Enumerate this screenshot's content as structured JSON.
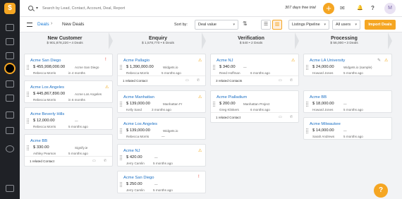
{
  "topbar": {
    "search_placeholder": "Search by Lead, Contact, Account, Deal, Report",
    "trial_text": "307 days free trial",
    "plus": "+",
    "mail_icon": "✉",
    "bell_icon": "🔔",
    "help_icon": "?",
    "avatar": "M",
    "search_caret": "▾"
  },
  "toolbar": {
    "deals_link": "Deals",
    "separator": "›",
    "current": "New Deals",
    "sort_label": "Sort by:",
    "sort_value": "Deal value",
    "sort_dir_icon": "⇅",
    "list_view_icon": "☰",
    "board_view_icon": "▥",
    "pipeline": "Listings Pipeline",
    "owner": "All users",
    "import_label": "Import Deals",
    "caret": "▾"
  },
  "columns": [
    {
      "title": "New Customer",
      "sub": "$ 901,878,220 • 4 Deals"
    },
    {
      "title": "Enquiry",
      "sub": "$ 1,578,770 • 6 Deals"
    },
    {
      "title": "Verification",
      "sub": "$ 540 • 2 Deals"
    },
    {
      "title": "Processing",
      "sub": "$ 56,000 • 3 Deals"
    }
  ],
  "cards": {
    "c1": {
      "name": "Acme San Diego",
      "value": "$ 455,998,000.00",
      "account": "Acme San Diego",
      "owner": "Rebecca Morris",
      "time": "in 4 months",
      "status": "!"
    },
    "c2": {
      "name": "Acme Los Angeles",
      "value": "$ 445,867,890.00",
      "account": "Acme Los Angeles",
      "owner": "Rebecca Morris",
      "time": "in 6 months",
      "status": "⚠"
    },
    "c3": {
      "name": "Acme Beverly Hills",
      "value": "$ 12,000.00",
      "account": "—",
      "owner": "Rebecca Morris",
      "time": "5 months ago"
    },
    "c4": {
      "name": "Acme BB",
      "value": "$ 330.00",
      "account": "Signify.ie",
      "owner": "Ashley Pearson",
      "time": "5 months ago",
      "footer": "1 related Contact"
    },
    "e1": {
      "name": "Acme Pallagio",
      "value": "$ 1,390,000.00",
      "account": "Widgets.io",
      "owner": "Rebecca Morris",
      "time": "5 months ago",
      "footer": "1 related Contact",
      "status": "⚠"
    },
    "e2": {
      "name": "Acme Manhattan",
      "value": "$ 139,000.00",
      "account": "Manhattan Fr",
      "owner": "Kelly Sand",
      "time": "3 months ago",
      "status": "⚠"
    },
    "e3": {
      "name": "Acme Los Angeles",
      "value": "$ 139,000.00",
      "account": "Widgets.io",
      "owner": "Rebecca Morris",
      "time": "—"
    },
    "e4": {
      "name": "Acme NJ",
      "value": "$ 420.00",
      "account": "—",
      "owner": "Jerry Camlin",
      "time": "5 months ago",
      "status": "⚠"
    },
    "e5": {
      "name": "Acme San Diego",
      "value": "$ 250.00",
      "account": "—",
      "owner": "Jerry Camlin",
      "time": "5 months ago",
      "status": "!"
    },
    "v1": {
      "name": "Acme NJ",
      "value": "$ 340.00",
      "account": "—",
      "owner": "Reed Hoffman",
      "time": "6 months ago",
      "footer": "3 related Contacts",
      "status": "⚠"
    },
    "v2": {
      "name": "Acme Pialladium",
      "value": "$ 200.00",
      "account": "Manhattan Project",
      "owner": "Greg Klinkers",
      "time": "6 months ago",
      "footer": "1 related Contact"
    },
    "p1": {
      "name": "Acme LA University",
      "value": "$ 24,000.00",
      "account": "Widgets.io (sample)",
      "owner": "Howard Jones",
      "time": "5 months ago",
      "status": "⚠"
    },
    "p2": {
      "name": "Acme BB",
      "value": "$ 18,000.00",
      "account": "—",
      "owner": "Howard Jones",
      "time": "5 months ago"
    },
    "p3": {
      "name": "Acme Milwaukee",
      "value": "$ 14,000.00",
      "account": "—",
      "owner": "Sarah Andrews",
      "time": "5 months ago"
    }
  },
  "footer_icons": {
    "note": "▭",
    "phone": "✆"
  },
  "help_button": "?"
}
